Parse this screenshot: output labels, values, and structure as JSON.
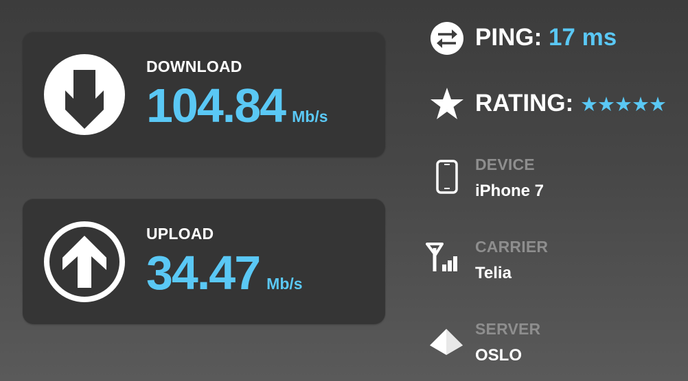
{
  "download": {
    "label": "DOWNLOAD",
    "value": "104.84",
    "unit": "Mb/s",
    "icon": "arrow-down-circle-icon"
  },
  "upload": {
    "label": "UPLOAD",
    "value": "34.47",
    "unit": "Mb/s",
    "icon": "arrow-up-circle-icon"
  },
  "ping": {
    "label": "PING:",
    "value": "17 ms",
    "icon": "exchange-arrows-icon"
  },
  "rating": {
    "label": "RATING:",
    "stars": "★★★★★",
    "score": 5,
    "max": 5,
    "icon": "star-icon"
  },
  "device": {
    "label": "DEVICE",
    "value": "iPhone 7",
    "icon": "phone-icon"
  },
  "carrier": {
    "label": "CARRIER",
    "value": "Telia",
    "icon": "antenna-signal-icon"
  },
  "server": {
    "label": "SERVER",
    "value": "OSLO",
    "icon": "pyramid-icon"
  },
  "colors": {
    "accent": "#5ac8f5",
    "card_bg": "#353535",
    "muted_label": "#8e8e8e",
    "text": "#ffffff"
  }
}
